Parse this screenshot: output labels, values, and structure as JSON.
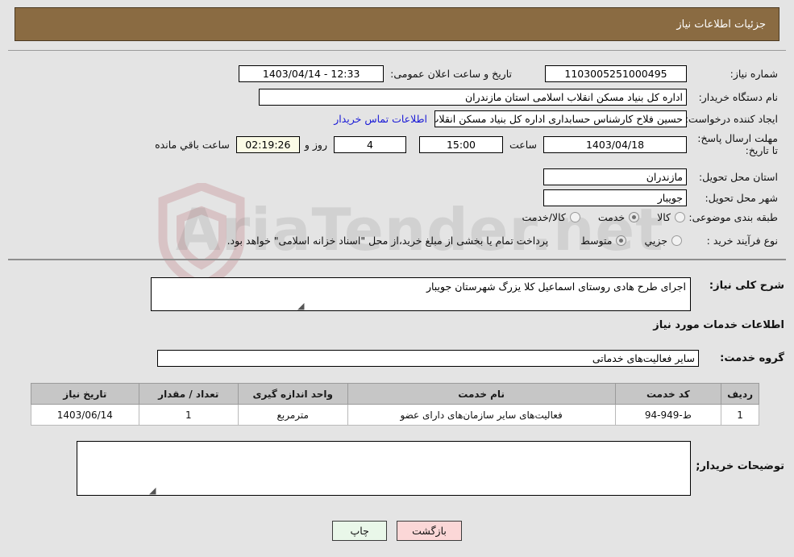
{
  "header": {
    "title": "جزئیات اطلاعات نیاز"
  },
  "watermark": {
    "text": "AriaTender.net",
    "icon": "shield-logo-icon"
  },
  "form": {
    "need_number": {
      "label": "شماره نیاز:",
      "value": "1103005251000495"
    },
    "public_announce": {
      "label": "تاریخ و ساعت اعلان عمومی:",
      "value": "12:33 - 1403/04/14"
    },
    "buyer_org": {
      "label": "نام دستگاه خریدار:",
      "value": "اداره کل بنیاد مسکن انقلاب اسلامی استان مازندران"
    },
    "requester": {
      "label": "ایجاد کننده درخواست:",
      "value": "حسین فلاح کارشناس حسابداری اداره کل بنیاد مسکن انقلاب اسلامی استان م",
      "contact_link": "اطلاعات تماس خریدار"
    },
    "deadline": {
      "label": "مهلت ارسال پاسخ: تا تاریخ:",
      "date": "1403/04/18",
      "hour_label": "ساعت",
      "hour": "15:00",
      "days": "4",
      "days_label": "روز و",
      "countdown": "02:19:26",
      "countdown_label": "ساعت باقي مانده"
    },
    "province": {
      "label": "استان محل تحویل:",
      "value": "مازندران"
    },
    "city": {
      "label": "شهر محل تحویل:",
      "value": "جویبار"
    },
    "category": {
      "label": "طبقه بندی موضوعی:",
      "options": [
        "کالا",
        "خدمت",
        "کالا/خدمت"
      ],
      "selected": "خدمت"
    },
    "purchase_type": {
      "label": "نوع فرآیند خرید :",
      "options": [
        "جزیي",
        "متوسط"
      ],
      "selected": "متوسط",
      "note": "پرداخت تمام یا بخشی از مبلغ خرید،از محل \"اسناد خزانه اسلامی\" خواهد بود."
    }
  },
  "sections": {
    "general_desc_label": "شرح کلی نیاز:",
    "general_desc_value": "اجرای طرح هادی روستای اسماعیل کلا یزرگ شهرستان جویبار",
    "services_heading": "اطلاعات خدمات مورد نیاز",
    "service_group_label": "گروه خدمت:",
    "service_group_value": "سایر فعالیت‌های خدماتی",
    "buyer_notes_label": "توضیحات خریدار;",
    "buyer_notes_value": ""
  },
  "table": {
    "columns": [
      "ردیف",
      "کد خدمت",
      "نام خدمت",
      "واحد اندازه گیری",
      "تعداد / مقدار",
      "تاریخ نیاز"
    ],
    "rows": [
      {
        "row": "1",
        "code": "ط-949-94",
        "name": "فعالیت‌های سایر سازمان‌های دارای عضو",
        "unit": "مترمربع",
        "qty": "1",
        "date": "1403/06/14"
      }
    ]
  },
  "buttons": {
    "print": "چاپ",
    "back": "بازگشت"
  },
  "colors": {
    "header_bg": "#8a6b42",
    "page_bg": "#e4e4e4",
    "link": "#1a1ad6",
    "table_header_bg": "#c6c6c6",
    "print_btn_bg": "#e9f7e9",
    "back_btn_bg": "#fbd7d7",
    "countdown_bg": "#fbfbe6"
  }
}
